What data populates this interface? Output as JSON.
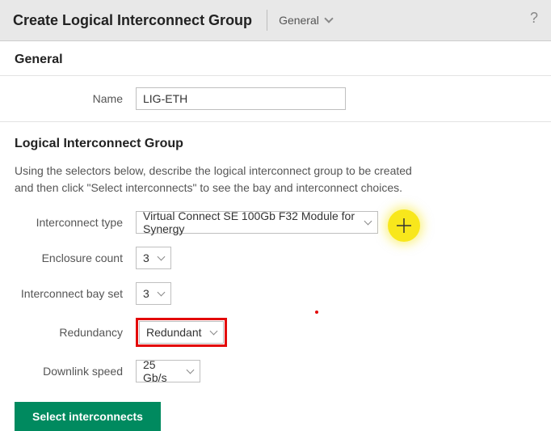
{
  "header": {
    "title": "Create Logical Interconnect Group",
    "dropdown": "General",
    "help": "?"
  },
  "general": {
    "title": "General",
    "name_label": "Name",
    "name_value": "LIG-ETH"
  },
  "lig": {
    "title": "Logical Interconnect Group",
    "description": "Using the selectors below, describe the logical interconnect group to be created and then click \"Select interconnects\" to see the bay and interconnect choices.",
    "interconnect_type_label": "Interconnect type",
    "interconnect_type_value": "Virtual Connect SE 100Gb F32 Module for Synergy",
    "enclosure_count_label": "Enclosure count",
    "enclosure_count_value": "3",
    "bay_set_label": "Interconnect bay set",
    "bay_set_value": "3",
    "redundancy_label": "Redundancy",
    "redundancy_value": "Redundant",
    "downlink_label": "Downlink speed",
    "downlink_value": "25 Gb/s",
    "select_button": "Select interconnects"
  }
}
